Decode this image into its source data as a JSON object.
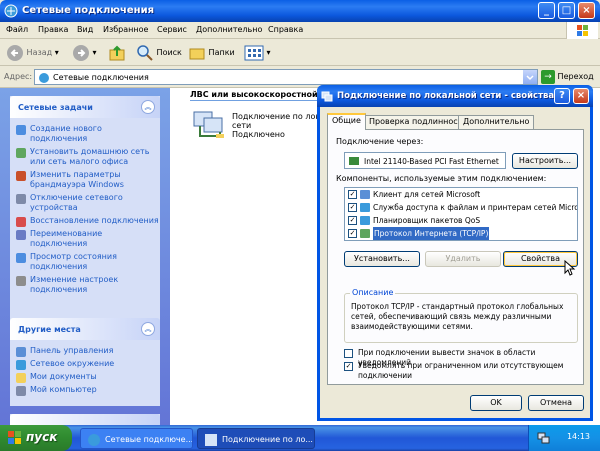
{
  "window": {
    "title": "Сетевые подключения"
  },
  "menu": [
    "Файл",
    "Правка",
    "Вид",
    "Избранное",
    "Сервис",
    "Дополнительно",
    "Справка"
  ],
  "toolbar": {
    "back": "Назад",
    "search": "Поиск",
    "folders": "Папки"
  },
  "address": {
    "label": "Адрес:",
    "value": "Сетевые подключения",
    "go": "Переход"
  },
  "tasks": {
    "network_title": "Сетевые задачи",
    "network_items": [
      "Создание нового подключения",
      "Установить домашнюю сеть или сеть малого офиса",
      "Изменить параметры брандмауэра Windows",
      "Отключение сетевого устройства",
      "Восстановление подключения",
      "Переименование подключения",
      "Просмотр состояния подключения",
      "Изменение настроек подключения"
    ],
    "places_title": "Другие места",
    "places_items": [
      "Панель управления",
      "Сетевое окружение",
      "Мои документы",
      "Мой компьютер"
    ]
  },
  "content": {
    "section_title": "ЛВС или высокоскоростной И",
    "connection_name": "Подключение по лок",
    "connection_line2": "сети",
    "connection_status": "Подключено"
  },
  "dialog": {
    "title": "Подключение по локальной сети - свойства",
    "tabs": [
      "Общие",
      "Проверка подлинности",
      "Дополнительно"
    ],
    "connect_using_label": "Подключение через:",
    "adapter": "Intel 21140-Based PCI Fast Ethernet",
    "configure_button": "Настроить...",
    "components_label": "Компоненты, используемые этим подключением:",
    "components": [
      "Клиент для сетей Microsoft",
      "Служба доступа к файлам и принтерам сетей Micro...",
      "Планировщик пакетов QoS",
      "Протокол Интернета (TCP/IP)"
    ],
    "install_button": "Установить...",
    "uninstall_button": "Удалить",
    "properties_button": "Свойства",
    "description_label": "Описание",
    "description_text": "Протокол TCP/IP - стандартный протокол глобальных сетей, обеспечивающий связь между различными взаимодействующими сетями.",
    "show_icon_label": "При подключении вывести значок в области уведомлений",
    "notify_label": "Уведомлять при ограниченном или отсутствующем подключении",
    "ok_button": "OK",
    "cancel_button": "Отмена"
  },
  "taskbar": {
    "start": "пуск",
    "task1": "Сетевые подключе...",
    "task2": "Подключение по ло...",
    "clock": "14:13"
  }
}
